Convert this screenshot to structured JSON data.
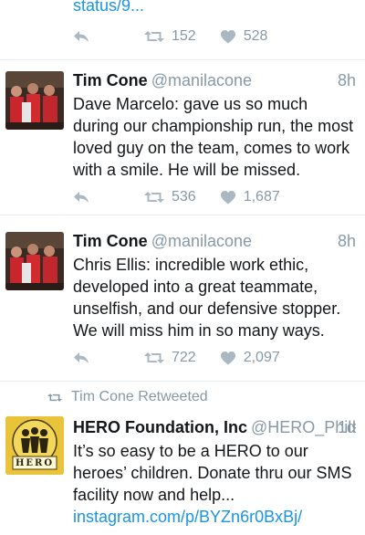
{
  "tweets": [
    {
      "text_tail": "status/9...",
      "retweets": "152",
      "likes": "528"
    },
    {
      "name": "Tim Cone",
      "handle": "@manilacone",
      "time": "8h",
      "text": "Dave Marcelo: gave us so much during our championship run, the most loved guy on the team, comes to work with a smile.  He will be missed.",
      "retweets": "536",
      "likes": "1,687"
    },
    {
      "name": "Tim Cone",
      "handle": "@manilacone",
      "time": "8h",
      "text": "Chris Ellis: incredible work ethic, developed into a great teammate, unselfish, and our defensive stopper. We will miss him in so many ways.",
      "retweets": "722",
      "likes": "2,097"
    },
    {
      "retweeted_by": "Tim Cone Retweeted",
      "name": "HERO Foundation, Inc",
      "handle": "@HERO_Phils",
      "time": "1d",
      "text": "It’s so easy to be a HERO to our heroes’ children. Donate thru our SMS facility now and help...",
      "link": "instagram.com/p/BYZn6r0BxBj/",
      "logo_text": "HERO"
    }
  ],
  "colors": {
    "link": "#1b95e0",
    "muted": "#8899a6",
    "icon": "#aab8c2",
    "divider": "#e6ecf0"
  },
  "icons": [
    "reply-icon",
    "retweet-icon",
    "like-icon"
  ]
}
